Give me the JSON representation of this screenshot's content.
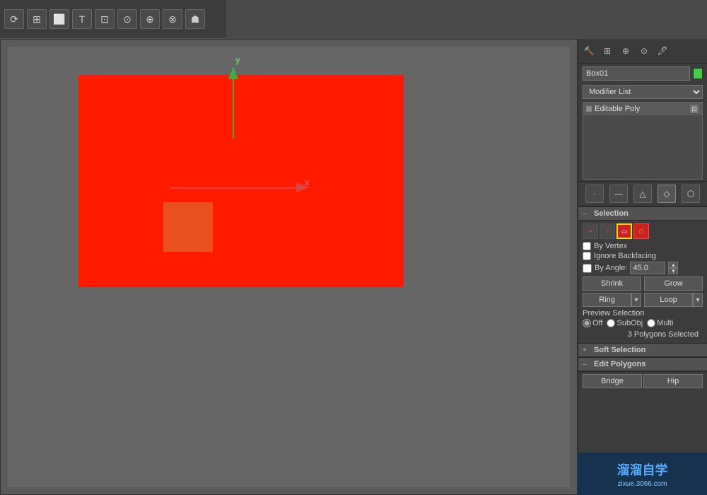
{
  "toolbar": {
    "icons": [
      "⟳",
      "⊞",
      "⬜",
      "T",
      "⊡",
      "⊙",
      "⊕",
      "⊗",
      "☗"
    ]
  },
  "panel_icons": [
    "⚙",
    "🗗",
    "⊞",
    "⊙",
    "🖊"
  ],
  "object": {
    "name": "Box01",
    "color": "#44cc44"
  },
  "modifier_list": {
    "label": "Modifier List",
    "placeholder": "Modifier List"
  },
  "modifier_stack": {
    "items": [
      {
        "name": "Editable Poly"
      }
    ]
  },
  "subobj_icons": [
    "·",
    "—",
    "△",
    "◇",
    "⬡"
  ],
  "selection": {
    "title": "Selection",
    "by_vertex": "By Vertex",
    "ignore_backfacing": "Ignore Backfacing",
    "by_angle_label": "By Angle:",
    "by_angle_value": "45.0",
    "shrink": "Shrink",
    "grow": "Grow",
    "ring": "Ring",
    "loop": "Loop",
    "preview_selection": "Preview Selection",
    "preview_off": "Off",
    "preview_subobj": "SubObj",
    "preview_multi": "Multi",
    "status": "3 Polygons Selected"
  },
  "soft_selection": {
    "title": "Soft Selection"
  },
  "edit_polygons": {
    "title": "Edit Polygons"
  },
  "bottom_buttons": {
    "bridge": "Bridge",
    "hip": "Hip"
  },
  "watermark": {
    "logo": "溜溜自学",
    "url": "zixue.3066.com"
  },
  "viewport": {
    "y_label": "y",
    "x_label": "x"
  }
}
